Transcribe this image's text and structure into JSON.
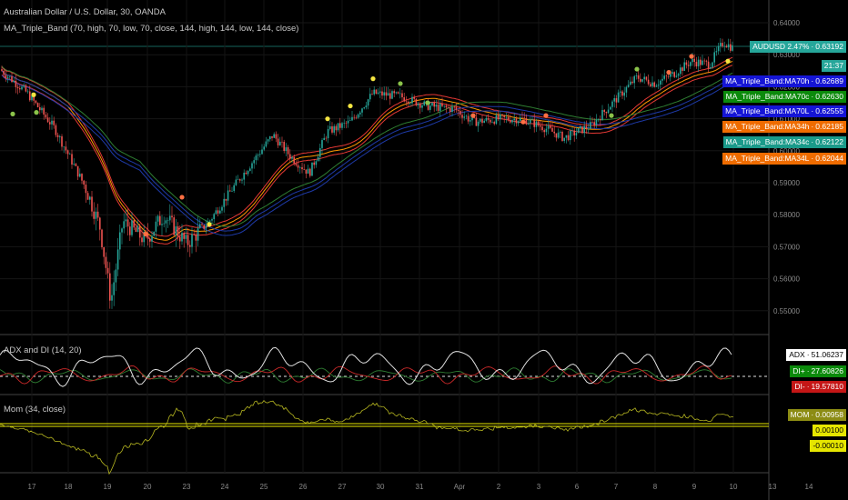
{
  "header": {
    "symbol_title": "Australian Dollar / U.S. Dollar, 30, OANDA",
    "indicator_main": "MA_Triple_Band (70, high, 70, low, 70, close, 144, high, 144, low, 144, close)",
    "indicator_adx": "ADX and DI (14, 20)",
    "indicator_mom": "Mom (34, close)"
  },
  "price_axis": {
    "ticks": [
      "0.64000",
      "0.63000",
      "0.62000",
      "0.61000",
      "0.60000",
      "0.59000",
      "0.58000",
      "0.57000",
      "0.56000",
      "0.55000"
    ]
  },
  "time_axis": {
    "ticks": [
      "17",
      "18",
      "19",
      "20",
      "23",
      "24",
      "25",
      "26",
      "27",
      "30",
      "31",
      "Apr",
      "2",
      "3",
      "6",
      "7",
      "8",
      "9",
      "10",
      "13",
      "14"
    ]
  },
  "price_tags": [
    {
      "label": "AUDUSD 2.47%",
      "value": "0.63192",
      "color": "#26a69a"
    },
    {
      "label": "",
      "value": "21:37",
      "color": "#26a69a"
    },
    {
      "label": "MA_Triple_Band:MA70h",
      "value": "0.62689",
      "color": "#1515d6"
    },
    {
      "label": "MA_Triple_Band:MA70c",
      "value": "0.62630",
      "color": "#0b8a0b"
    },
    {
      "label": "MA_Triple_Band:MA70L",
      "value": "0.62555",
      "color": "#1515d6"
    },
    {
      "label": "MA_Triple_Band:MA34h",
      "value": "0.62185",
      "color": "#ef6c00"
    },
    {
      "label": "MA_Triple_Band:MA34c",
      "value": "0.62122",
      "color": "#1a9a8a"
    },
    {
      "label": "MA_Triple_Band:MA34L",
      "value": "0.62044",
      "color": "#ef6c00"
    }
  ],
  "adx_tags": [
    {
      "label": "ADX",
      "value": "51.06237",
      "color": "#ffffff",
      "text": "#000000"
    },
    {
      "label": "DI+",
      "value": "27.60826",
      "color": "#0b8a0b",
      "text": "#ffffff"
    },
    {
      "label": "DI-",
      "value": "19.57810",
      "color": "#c51616",
      "text": "#ffffff"
    }
  ],
  "mom_tags": [
    {
      "label": "MOM",
      "value": "0.00958",
      "color": "#8c8c14",
      "text": "#ffffff"
    },
    {
      "label": "",
      "value": "0.00100",
      "color": "#e6e600",
      "text": "#000000"
    },
    {
      "label": "",
      "value": "-0.00010",
      "color": "#e6e600",
      "text": "#000000"
    }
  ],
  "colors": {
    "background": "#000000",
    "up_candle": "#26a69a",
    "down_candle": "#ef5350",
    "band_red": "#e53935",
    "band_orange": "#ff9800",
    "band_green": "#2e7d32",
    "band_blue": "#1e3aa8",
    "adx": "#e0e0e0",
    "di_plus": "#2e7d32",
    "di_minus": "#c62828",
    "mom": "#b5b520"
  }
}
